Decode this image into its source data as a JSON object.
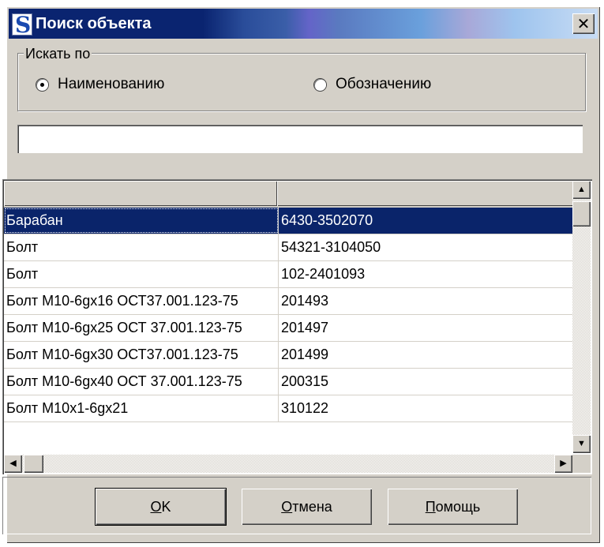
{
  "window": {
    "title": "Поиск объекта",
    "close_glyph": "✕"
  },
  "search_by": {
    "legend": "Искать по",
    "options": [
      {
        "label": "Наименованию",
        "checked": true
      },
      {
        "label": "Обозначению",
        "checked": false
      }
    ]
  },
  "search": {
    "value": "",
    "placeholder": ""
  },
  "table": {
    "headers": [
      "",
      ""
    ],
    "rows": [
      {
        "name": "Барабан",
        "code": "6430-3502070",
        "selected": true
      },
      {
        "name": "Болт",
        "code": "54321-3104050"
      },
      {
        "name": "Болт",
        "code": "102-2401093"
      },
      {
        "name": "Болт М10-6gx16 ОСТ37.001.123-75",
        "code": "201493"
      },
      {
        "name": "Болт М10-6gx25 ОСТ 37.001.123-75",
        "code": "201497"
      },
      {
        "name": "Болт М10-6gx30 ОСТ37.001.123-75",
        "code": "201499"
      },
      {
        "name": "Болт М10-6gx40 ОСТ 37.001.123-75",
        "code": "200315"
      },
      {
        "name": "Болт М10х1-6gx21",
        "code": "310122"
      }
    ]
  },
  "buttons": {
    "ok": {
      "accel": "О",
      "rest": "K"
    },
    "cancel": {
      "accel": "О",
      "rest": "тмена"
    },
    "help": {
      "accel": "П",
      "rest": "омощь"
    }
  },
  "icons": {
    "app": "app-logo-icon",
    "scroll_up": "▲",
    "scroll_down": "▼",
    "scroll_left": "◀",
    "scroll_right": "▶"
  },
  "colors": {
    "selection": "#0a246a",
    "face": "#d4d0c8",
    "title_start": "#0a2470"
  }
}
